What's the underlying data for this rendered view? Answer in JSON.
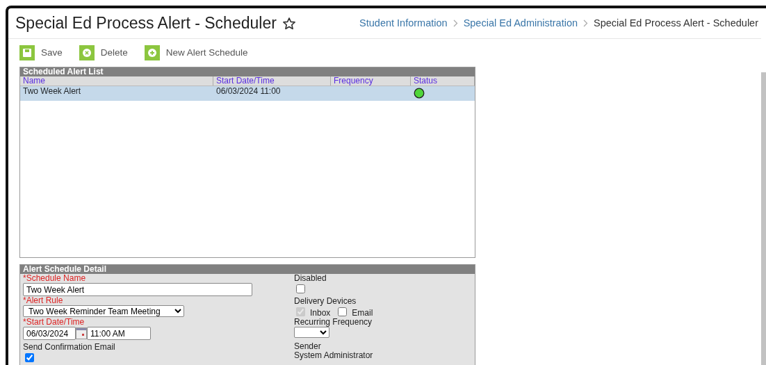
{
  "page": {
    "title": "Special Ed Process Alert - Scheduler",
    "favorite": false
  },
  "breadcrumbs": [
    {
      "label": "Student Information",
      "link": true
    },
    {
      "label": "Special Ed Administration",
      "link": true
    },
    {
      "label": "Special Ed Process Alert - Scheduler",
      "link": false
    }
  ],
  "toolbar": [
    {
      "label": "Save",
      "kind": "save"
    },
    {
      "label": "Delete",
      "kind": "delete"
    },
    {
      "label": "New Alert Schedule",
      "kind": "add"
    }
  ],
  "list": {
    "title": "Scheduled Alert List",
    "columns": [
      "Name",
      "Start Date/Time",
      "Frequency",
      "Status"
    ],
    "rows": [
      {
        "name": "Two Week Alert",
        "start": "06/03/2024 11:00",
        "color": "#4fd63a",
        "selected": true
      }
    ]
  },
  "detail": {
    "title": "Alert Schedule Detail",
    "schedule_name": {
      "label": "*Schedule Name",
      "value": "Two Week Alert",
      "required": true
    },
    "alert_rule": {
      "label": "*Alert Rule",
      "value": "Two Week Reminder Team Meeting",
      "required": true
    },
    "start": {
      "label": "*Start Date/Time",
      "date": "06/03/2024",
      "time": "11:00 AM",
      "required": true
    },
    "send_confirmation": {
      "label": "Send Confirmation Email",
      "checked": true
    },
    "disabled": {
      "label": "Disabled",
      "checked": false
    },
    "delivery": {
      "label": "Delivery Devices",
      "options": [
        {
          "label": "Inbox",
          "checked": true,
          "disabled": true
        },
        {
          "label": "Email",
          "checked": false,
          "disabled": false
        }
      ]
    },
    "recurring": {
      "label": "Recurring Frequency"
    },
    "sender": {
      "label": "Sender",
      "value": "System Administrator"
    }
  }
}
